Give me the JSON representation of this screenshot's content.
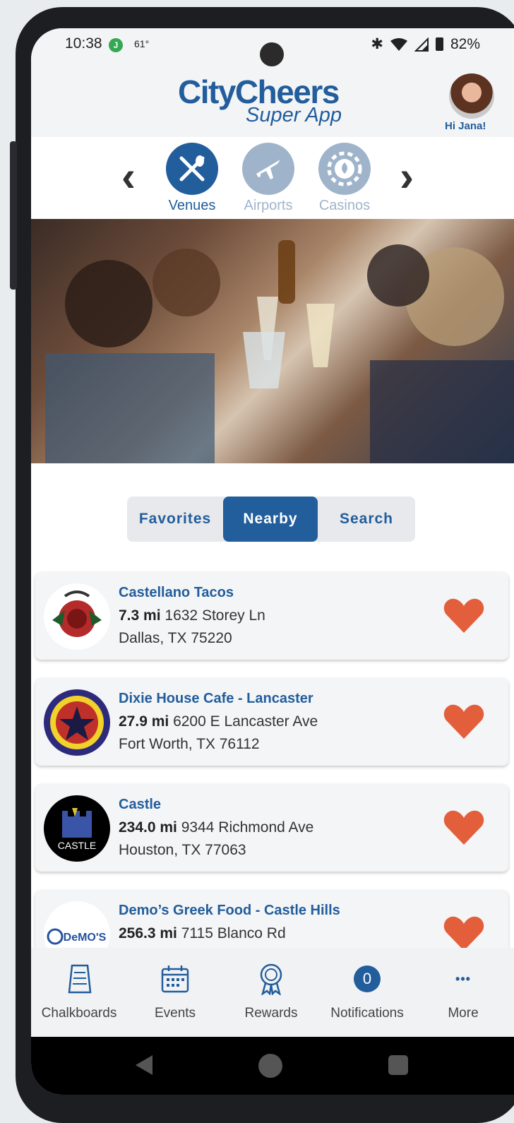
{
  "status": {
    "time": "10:38",
    "badge": "J",
    "temp": "61°",
    "battery": "82%"
  },
  "app": {
    "brand_line1": "CityCheers",
    "brand_line2": "Super App",
    "greeting": "Hi Jana!"
  },
  "categories": [
    {
      "label": "Venues",
      "icon": "fork-knife-icon",
      "active": true
    },
    {
      "label": "Airports",
      "icon": "airplane-icon",
      "active": false
    },
    {
      "label": "Casinos",
      "icon": "casino-chip-icon",
      "active": false
    }
  ],
  "tabs": [
    {
      "label": "Favorites",
      "active": false
    },
    {
      "label": "Nearby",
      "active": true
    },
    {
      "label": "Search",
      "active": false
    }
  ],
  "venues": [
    {
      "name": "Castellano  Tacos",
      "distance": "7.3 mi",
      "street": "1632 Storey Ln",
      "city": "Dallas, TX 75220"
    },
    {
      "name": "Dixie House Cafe - Lancaster",
      "distance": "27.9 mi",
      "street": "6200 E Lancaster Ave",
      "city": "Fort Worth, TX 76112"
    },
    {
      "name": "Castle",
      "distance": "234.0 mi",
      "street": "9344 Richmond Ave",
      "city": "Houston, TX 77063",
      "logo_text": "CASTLE"
    },
    {
      "name": "Demo’s Greek Food - Castle Hills",
      "distance": "256.3 mi",
      "street": "7115 Blanco Rd",
      "city": "",
      "logo_text": "DeMO'S"
    }
  ],
  "bottom_nav": [
    {
      "label": "Chalkboards",
      "icon": "chalkboard-icon"
    },
    {
      "label": "Events",
      "icon": "calendar-icon"
    },
    {
      "label": "Rewards",
      "icon": "rewards-badge-icon"
    },
    {
      "label": "Notifications",
      "icon": "notification-count",
      "count": "0"
    },
    {
      "label": "More",
      "icon": "more-dots-icon",
      "glyph": "•••"
    }
  ],
  "colors": {
    "brand_blue": "#225d9c",
    "heart": "#e35f3c",
    "inactive_icon": "#9fb4cb"
  }
}
